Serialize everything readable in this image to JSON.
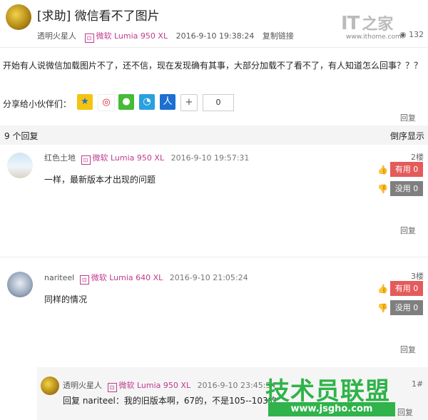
{
  "post": {
    "title": "[求助] 微信看不了图片",
    "author": "透明火星人",
    "device": "微软 Lumia 950 XL",
    "time": "2016-9-10 19:38:24",
    "copy_link": "复制链接",
    "view_count": "132",
    "content": "开始有人说微信加载图片不了，还不信，现在发现确有其事，大部分加载不了看不了，有人知道怎么回事？？？",
    "reply_label": "回复"
  },
  "logo": {
    "it": "IT",
    "zhi": "之家",
    "domain": "www.ithome.com"
  },
  "share": {
    "label": "分享给小伙伴们：",
    "count": "0",
    "icons": [
      "qzone-icon",
      "weibo-icon",
      "wechat-icon",
      "tencent-weibo-icon",
      "renren-icon",
      "more-share-icon"
    ]
  },
  "replies_header": {
    "count": "9 个回复",
    "sort": "倒序显示"
  },
  "replies": [
    {
      "user": "红色土地",
      "device": "微软 Lumia 950 XL",
      "time": "2016-9-10 19:57:31",
      "floor": "2楼",
      "content": "一样，最新版本才出现的问题",
      "useful": "有用 0",
      "useless": "没用 0",
      "reply": "回复"
    },
    {
      "user": "nariteel",
      "device": "微软 Lumia 640 XL",
      "time": "2016-9-10 21:05:24",
      "floor": "3楼",
      "content": "同样的情况",
      "useful": "有用 0",
      "useless": "没用 0",
      "reply": "回复"
    }
  ],
  "nested_reply": {
    "user": "透明火星人",
    "device": "微软 Lumia 950 XL",
    "time": "2016-9-10 23:45:54",
    "floor": "1#",
    "content": "回复 nariteel：我的旧版本啊，67的，不是105--103的",
    "reply": "回复"
  },
  "watermark": {
    "name": "技术员联盟",
    "url": "www.jsgho.com"
  },
  "colors": {
    "accent": "#e45b5b",
    "device": "#c03a8e",
    "grey_btn": "#7f7f7f",
    "watermark": "#2fb34a"
  }
}
